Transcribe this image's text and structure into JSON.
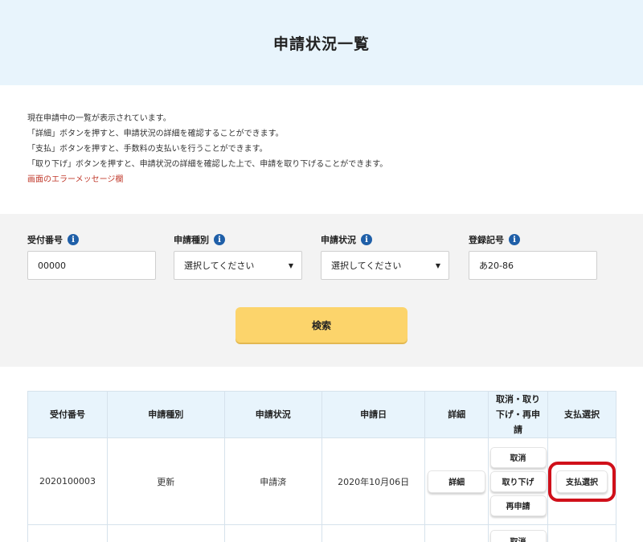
{
  "header": {
    "title": "申請状況一覧"
  },
  "intro": {
    "lines": [
      "現在申請中の一覧が表示されています。",
      "「詳細」ボタンを押すと、申請状況の詳細を確認することができます。",
      "「支払」ボタンを押すと、手数料の支払いを行うことができます。",
      "「取り下げ」ボタンを押すと、申請状況の詳細を確認した上で、申請を取り下げることができます。"
    ],
    "error": "画面のエラーメッセージ欄"
  },
  "search": {
    "fields": [
      {
        "label": "受付番号",
        "value": "00000"
      },
      {
        "label": "申請種別",
        "value": "選択してください"
      },
      {
        "label": "申請状況",
        "value": "選択してください"
      },
      {
        "label": "登録記号",
        "value": "あ20-86"
      }
    ],
    "info_icon": "i",
    "select_arrow": "▼",
    "button": "検索"
  },
  "table": {
    "headers": [
      "受付番号",
      "申請種別",
      "申請状況",
      "申請日",
      "詳細",
      "取消・取り下げ・再申請",
      "支払選択"
    ],
    "rows": [
      {
        "receipt_no": "2020100003",
        "type": "更新",
        "status": "申請済",
        "date": "2020年10月06日",
        "detail": "詳細",
        "actions": [
          "取消",
          "取り下げ",
          "再申請"
        ],
        "pay": "支払選択"
      },
      {
        "actions": [
          "取消"
        ]
      }
    ]
  },
  "colors": {
    "header_bg": "#e8f4fc",
    "search_button": "#fcd46b",
    "info_icon": "#1f5fa8",
    "highlight": "#d0101a",
    "error_text": "#c0392b"
  }
}
